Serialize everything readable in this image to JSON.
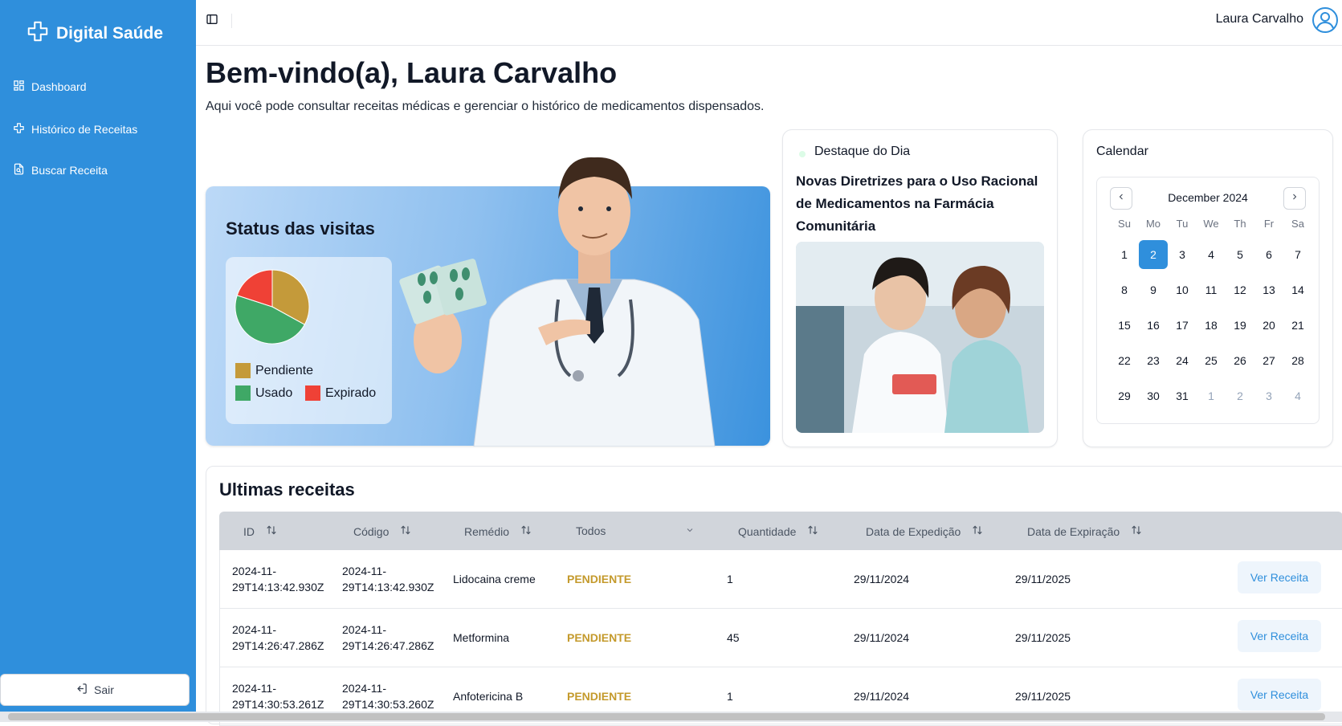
{
  "sidebar": {
    "brand": "Digital Saúde",
    "items": [
      {
        "label": "Dashboard",
        "icon": "grid-icon"
      },
      {
        "label": "Histórico de Receitas",
        "icon": "medical-cross-icon"
      },
      {
        "label": "Buscar Receita",
        "icon": "document-search-icon"
      }
    ],
    "logout_label": "Sair"
  },
  "header": {
    "user_name": "Laura Carvalho"
  },
  "main": {
    "welcome": "Bem-vindo(a), Laura Carvalho",
    "subtitle": "Aqui você pode consultar receitas médicas e gerenciar o histórico de medicamentos dispensados."
  },
  "status_card": {
    "title": "Status das visitas",
    "legend": [
      {
        "label": "Pendiente",
        "color": "#c49a3a"
      },
      {
        "label": "Usado",
        "color": "#3fa866"
      },
      {
        "label": "Expirado",
        "color": "#ef4136"
      }
    ]
  },
  "chart_data": {
    "type": "pie",
    "categories": [
      "Pendiente",
      "Usado",
      "Expirado"
    ],
    "values": [
      33,
      47,
      20
    ],
    "colors": [
      "#c49a3a",
      "#3fa866",
      "#ef4136"
    ],
    "legend": "bottom"
  },
  "destaque": {
    "label": "Destaque do Dia",
    "title": "Novas Diretrizes para o Uso Racional de Medicamentos na Farmácia Comunitária"
  },
  "calendar": {
    "title": "Calendar",
    "month": "December 2024",
    "weekdays": [
      "Su",
      "Mo",
      "Tu",
      "We",
      "Th",
      "Fr",
      "Sa"
    ],
    "days": [
      "1",
      "2",
      "3",
      "4",
      "5",
      "6",
      "7",
      "8",
      "9",
      "10",
      "11",
      "12",
      "13",
      "14",
      "15",
      "16",
      "17",
      "18",
      "19",
      "20",
      "21",
      "22",
      "23",
      "24",
      "25",
      "26",
      "27",
      "28",
      "29",
      "30",
      "31",
      "1",
      "2",
      "3",
      "4"
    ],
    "selected": "2"
  },
  "receipts": {
    "title": "Ultimas receitas",
    "columns": [
      "ID",
      "Código",
      "Remédio",
      "Todos",
      "Quantidade",
      "Data de Expedição",
      "Data de Expiração"
    ],
    "rows": [
      {
        "id_1": "2024-11-",
        "id_2": "29T14:13:42.930Z",
        "code_1": "2024-11-",
        "code_2": "29T14:13:42.930Z",
        "remedy": "Lidocaina creme",
        "status": "PENDIENTE",
        "qty": "1",
        "issued": "29/11/2024",
        "expires": "29/11/2025",
        "action": "Ver Receita"
      },
      {
        "id_1": "2024-11-",
        "id_2": "29T14:26:47.286Z",
        "code_1": "2024-11-",
        "code_2": "29T14:26:47.286Z",
        "remedy": "Metformina",
        "status": "PENDIENTE",
        "qty": "45",
        "issued": "29/11/2024",
        "expires": "29/11/2025",
        "action": "Ver Receita"
      },
      {
        "id_1": "2024-11-",
        "id_2": "29T14:30:53.261Z",
        "code_1": "2024-11-",
        "code_2": "29T14:30:53.260Z",
        "remedy": "Anfotericina B",
        "status": "PENDIENTE",
        "qty": "1",
        "issued": "29/11/2024",
        "expires": "29/11/2025",
        "action": "Ver Receita"
      }
    ]
  }
}
